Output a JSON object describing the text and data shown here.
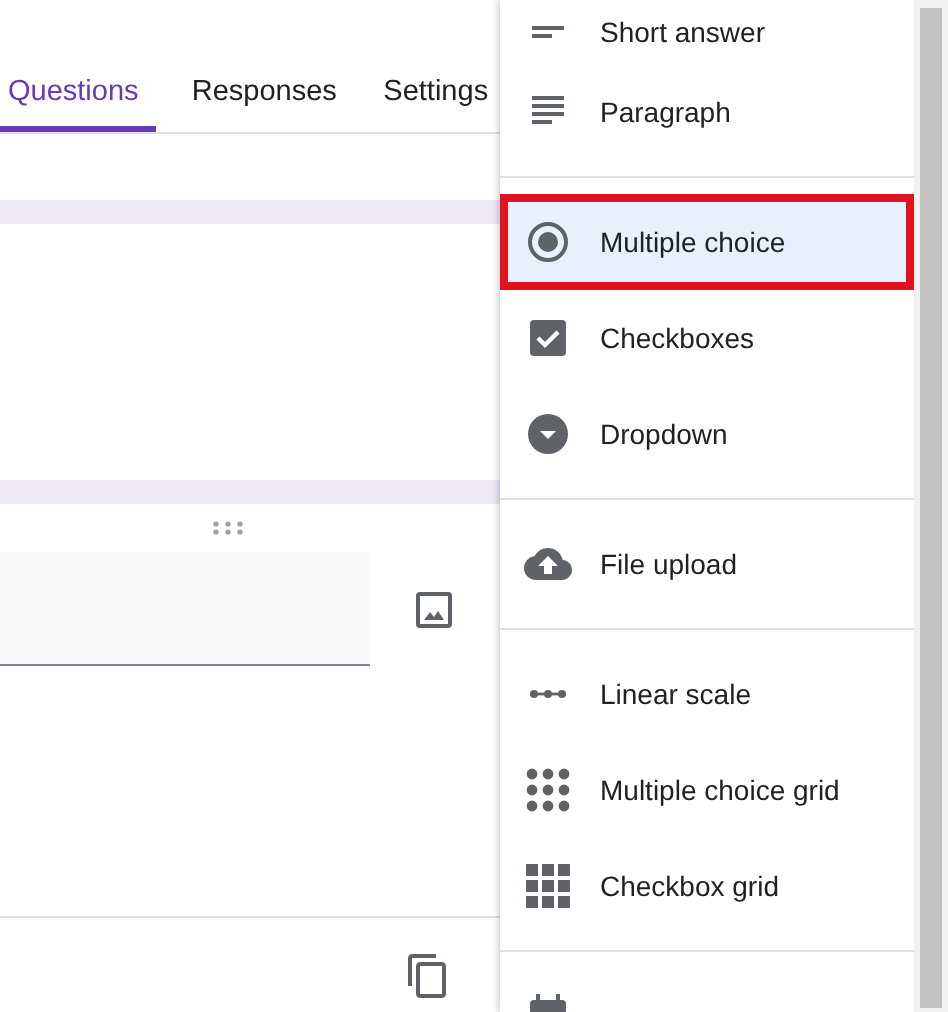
{
  "tabs": [
    {
      "label": "Questions",
      "selected": true
    },
    {
      "label": "Responses",
      "selected": false
    },
    {
      "label": "Settings",
      "selected": false
    }
  ],
  "question_types": [
    {
      "items": [
        {
          "label": "Short answer",
          "kind": "short",
          "selected": false,
          "outlined": false
        },
        {
          "label": "Paragraph",
          "kind": "paragraph",
          "selected": false,
          "outlined": false
        }
      ]
    },
    {
      "items": [
        {
          "label": "Multiple choice",
          "kind": "radio",
          "selected": true,
          "outlined": true
        },
        {
          "label": "Checkboxes",
          "kind": "checkbox",
          "selected": false,
          "outlined": false
        },
        {
          "label": "Dropdown",
          "kind": "dropdown",
          "selected": false,
          "outlined": false
        }
      ]
    },
    {
      "items": [
        {
          "label": "File upload",
          "kind": "upload",
          "selected": false,
          "outlined": false
        }
      ]
    },
    {
      "items": [
        {
          "label": "Linear scale",
          "kind": "scale",
          "selected": false,
          "outlined": false
        },
        {
          "label": "Multiple choice grid",
          "kind": "dotgrid",
          "selected": false,
          "outlined": false
        },
        {
          "label": "Checkbox grid",
          "kind": "squaregrid",
          "selected": false,
          "outlined": false
        }
      ]
    },
    {
      "items": [
        {
          "kind": "calendar",
          "selected": false,
          "outlined": false
        }
      ]
    }
  ]
}
